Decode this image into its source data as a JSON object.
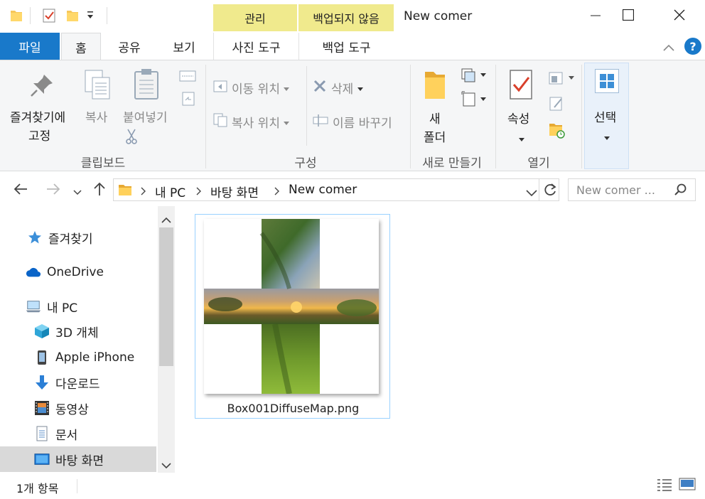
{
  "titlebar": {
    "window_title": "New comer",
    "context_headers": [
      {
        "label": "관리"
      },
      {
        "label": "백업되지 않음"
      }
    ],
    "controls": [
      "minimize-icon",
      "maximize-icon",
      "close-icon"
    ]
  },
  "tabs": {
    "file": "파일",
    "home": "홈",
    "share": "공유",
    "view": "보기",
    "photo_tools": "사진 도구",
    "backup_tools": "백업 도구"
  },
  "ribbon": {
    "clipboard": {
      "pin_label_1": "즐겨찾기에",
      "pin_label_2": "고정",
      "copy": "복사",
      "paste": "붙여넣기",
      "group": "클립보드"
    },
    "organize": {
      "move_to": "이동 위치",
      "copy_to": "복사 위치",
      "delete": "삭제",
      "rename": "이름 바꾸기",
      "group": "구성"
    },
    "new": {
      "new_folder_1": "새",
      "new_folder_2": "폴더",
      "group": "새로 만들기"
    },
    "open": {
      "properties": "속성",
      "group": "열기"
    },
    "select": {
      "label": "선택"
    }
  },
  "navigation": {
    "path": [
      "내 PC",
      "바탕 화면",
      "New comer"
    ],
    "search_placeholder": "New comer ..."
  },
  "sidebar": {
    "items": [
      {
        "label": "즐겨찾기",
        "icon": "star-icon"
      },
      {
        "label": "OneDrive",
        "icon": "cloud-icon"
      },
      {
        "label": "내 PC",
        "icon": "computer-icon"
      },
      {
        "label": "3D 개체",
        "icon": "cube-icon"
      },
      {
        "label": "Apple iPhone",
        "icon": "phone-icon"
      },
      {
        "label": "다운로드",
        "icon": "download-arrow-icon"
      },
      {
        "label": "동영상",
        "icon": "film-icon"
      },
      {
        "label": "문서",
        "icon": "document-icon"
      },
      {
        "label": "바탕 화면",
        "icon": "desktop-icon"
      }
    ]
  },
  "files": [
    {
      "name": "Box001DiffuseMap.png"
    }
  ],
  "status": {
    "item_count": "1개 항목"
  },
  "colors": {
    "file_tab": "#1979ca",
    "context_header": "#f0ea8d",
    "selection_border": "#99d1ff"
  }
}
